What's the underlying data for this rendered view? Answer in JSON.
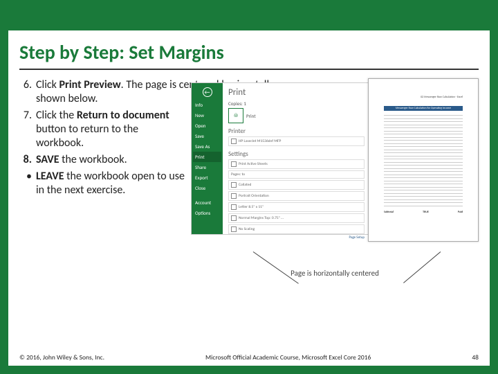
{
  "title": "Step by Step: Set Margins",
  "steps": [
    {
      "num": "6.",
      "parts": [
        "Click ",
        "Print Preview",
        ". The page is centered horizontally, as shown below."
      ],
      "bold": [
        1
      ]
    },
    {
      "num": "7.",
      "parts": [
        "Click the ",
        "Return to document",
        " button to return to the workbook."
      ],
      "bold": [
        1
      ]
    },
    {
      "num": "8.",
      "parts": [
        "SAVE",
        " the workbook."
      ],
      "bold": [
        0
      ],
      "numbold": true
    },
    {
      "num": "•",
      "parts": [
        "LEAVE",
        " the workbook open to use in the next exercise."
      ],
      "bold": [
        0
      ]
    }
  ],
  "step6_wrap": {
    "line1_pre": "Click ",
    "line1_bold": "Print Preview",
    "line1_post": ". The page is centered horizontally, as",
    "line2": "shown below."
  },
  "backstage": {
    "items": [
      "Info",
      "New",
      "Open",
      "Save",
      "Save As",
      "Print",
      "Share",
      "Export",
      "Close",
      "Account",
      "Options"
    ],
    "selected": "Print",
    "heading": "Print",
    "copies": "Copies:  1",
    "print_btn": "Print",
    "printer_section": "Printer",
    "printer_name": "HP LaserJet M1536dnf MFP",
    "settings_section": "Settings",
    "settings": [
      "Print Active Sheets",
      "Pages:       to",
      "Collated",
      "Portrait Orientation",
      "Letter  8.5\" x 11\"",
      "Normal Margins  Top: 0.75\" …",
      "No Scaling"
    ],
    "page_setup": "Page Setup"
  },
  "preview": {
    "header": "02 Messenger Row Calculation - Excel",
    "banner": "Messenger Row Calculation for Operating Income",
    "foot_left": "Subtotal",
    "foot_mid": "TRUE",
    "foot_right": "Paid"
  },
  "caption": "Page is horizontally centered",
  "footer": {
    "left": "© 2016, John Wiley & Sons, Inc.",
    "center": "Microsoft Official Academic Course, Microsoft Excel Core 2016",
    "right": "48"
  }
}
